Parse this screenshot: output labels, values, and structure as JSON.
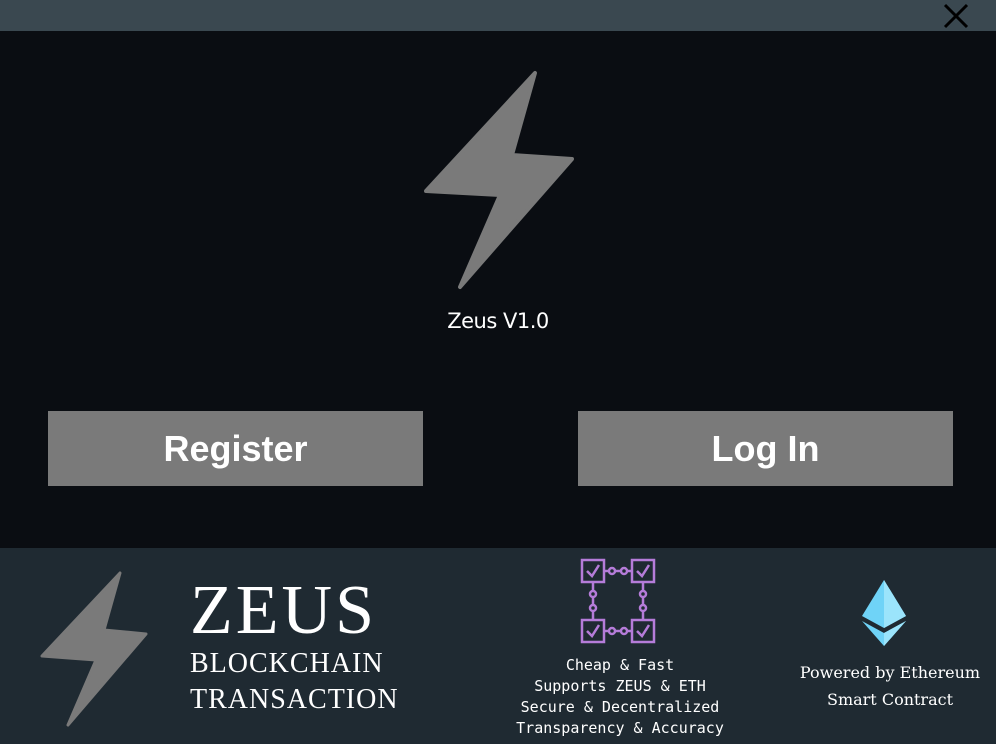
{
  "window": {
    "close_icon": "close-icon"
  },
  "app": {
    "version_label": "Zeus V1.0",
    "logo_icon": "lightning-bolt-icon"
  },
  "actions": {
    "register_label": "Register",
    "login_label": "Log In"
  },
  "footer": {
    "brand": {
      "name": "ZEUS",
      "line1": "BLOCKCHAIN",
      "line2": "TRANSACTION"
    },
    "features": [
      "Cheap & Fast",
      "Supports ZEUS & ETH",
      "Secure & Decentralized",
      "Transparency & Accuracy"
    ],
    "powered": {
      "line1": "Powered by Ethereum",
      "line2": "Smart Contract"
    }
  },
  "colors": {
    "background": "#0a0d12",
    "titlebar": "#3a4850",
    "footer": "#1f2a32",
    "button": "#7a7a7a",
    "bolt": "#7a7a7a",
    "chain_accent": "#b57cd9",
    "eth_accent": "#6fd3f7"
  }
}
